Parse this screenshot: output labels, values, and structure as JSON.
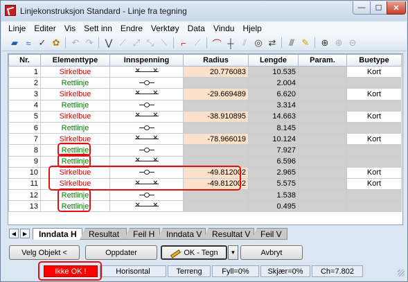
{
  "window": {
    "title": "Linjekonstruksjon Standard - Linje fra tegning",
    "min_label": "—",
    "max_label": "☐",
    "close_label": "✕"
  },
  "menu": [
    "Linje",
    "Editer",
    "Vis",
    "Sett inn",
    "Endre",
    "Verktøy",
    "Data",
    "Vindu",
    "Hjelp"
  ],
  "toolbar_icons": [
    "new-line-icon",
    "wave-icon",
    "check-icon",
    "settings-icon",
    "undo-icon",
    "redo-icon",
    "polyline-icon",
    "arc-curve-icon",
    "straight-icon",
    "spline-icon",
    "corner-icon",
    "curve-icon",
    "hat-icon",
    "cross-icon",
    "parallel-icon",
    "circle-icon",
    "swap-icon",
    "hatch-icon",
    "pencil-icon",
    "zoom-icon",
    "zoom-in-icon",
    "zoom-out-icon"
  ],
  "grid": {
    "columns": [
      "Nr.",
      "Elementtype",
      "Innspenning",
      "Radius",
      "Lengde",
      "Param.",
      "Buetype"
    ],
    "rows": [
      {
        "nr": "1",
        "type": "Sirkelbue",
        "innsp": "xx",
        "radius": "20.776083",
        "lengde": "10.535",
        "param": "",
        "buetype": "Kort"
      },
      {
        "nr": "2",
        "type": "Rettlinje",
        "innsp": "o",
        "radius": "",
        "lengde": "2.004",
        "param": "",
        "buetype": ""
      },
      {
        "nr": "3",
        "type": "Sirkelbue",
        "innsp": "xx",
        "radius": "-29.669489",
        "lengde": "6.620",
        "param": "",
        "buetype": "Kort"
      },
      {
        "nr": "4",
        "type": "Rettlinje",
        "innsp": "o",
        "radius": "",
        "lengde": "3.314",
        "param": "",
        "buetype": ""
      },
      {
        "nr": "5",
        "type": "Sirkelbue",
        "innsp": "xx",
        "radius": "-38.910895",
        "lengde": "14.663",
        "param": "",
        "buetype": "Kort"
      },
      {
        "nr": "6",
        "type": "Rettlinje",
        "innsp": "o",
        "radius": "",
        "lengde": "8.145",
        "param": "",
        "buetype": ""
      },
      {
        "nr": "7",
        "type": "Sirkelbue",
        "innsp": "xx",
        "radius": "-78.966019",
        "lengde": "10.124",
        "param": "",
        "buetype": "Kort"
      },
      {
        "nr": "8",
        "type": "Rettlinje",
        "innsp": "o",
        "radius": "",
        "lengde": "7.927",
        "param": "",
        "buetype": ""
      },
      {
        "nr": "9",
        "type": "Rettlinje",
        "innsp": "xx",
        "radius": "",
        "lengde": "6.596",
        "param": "",
        "buetype": ""
      },
      {
        "nr": "10",
        "type": "Sirkelbue",
        "innsp": "o",
        "radius": "-49.812002",
        "lengde": "2.965",
        "param": "",
        "buetype": "Kort"
      },
      {
        "nr": "11",
        "type": "Sirkelbue",
        "innsp": "xx",
        "radius": "-49.812002",
        "lengde": "5.575",
        "param": "",
        "buetype": "Kort"
      },
      {
        "nr": "12",
        "type": "Rettlinje",
        "innsp": "o",
        "radius": "",
        "lengde": "1.538",
        "param": "",
        "buetype": ""
      },
      {
        "nr": "13",
        "type": "Rettlinje",
        "innsp": "xx",
        "radius": "",
        "lengde": "0.495",
        "param": "",
        "buetype": ""
      }
    ]
  },
  "tabs": {
    "prev_label": "◀",
    "next_label": "▶",
    "items": [
      {
        "label": "Inndata H",
        "active": true
      },
      {
        "label": "Resultat H",
        "active": false
      },
      {
        "label": "Feil H",
        "active": false
      },
      {
        "label": "Inndata V",
        "active": false
      },
      {
        "label": "Resultat V",
        "active": false
      },
      {
        "label": "Feil V",
        "active": false
      }
    ]
  },
  "buttons": {
    "select": "Velg Objekt <",
    "update": "Oppdater",
    "ok": "OK - Tegn",
    "dropdown": "▼",
    "cancel": "Avbryt"
  },
  "status": {
    "ok_state": "Ikke OK !",
    "align": "Horisontal",
    "terrain": "Terreng",
    "fill": "Fyll=0%",
    "cut": "Skjær=0%",
    "ch": "Ch=7.802"
  },
  "colors": {
    "sirkelbue": "#d00000",
    "rettlinje": "#008000",
    "radius_bg": "#fbe1c9",
    "status_alert": "#ff0000",
    "highlight": "#e01010"
  }
}
